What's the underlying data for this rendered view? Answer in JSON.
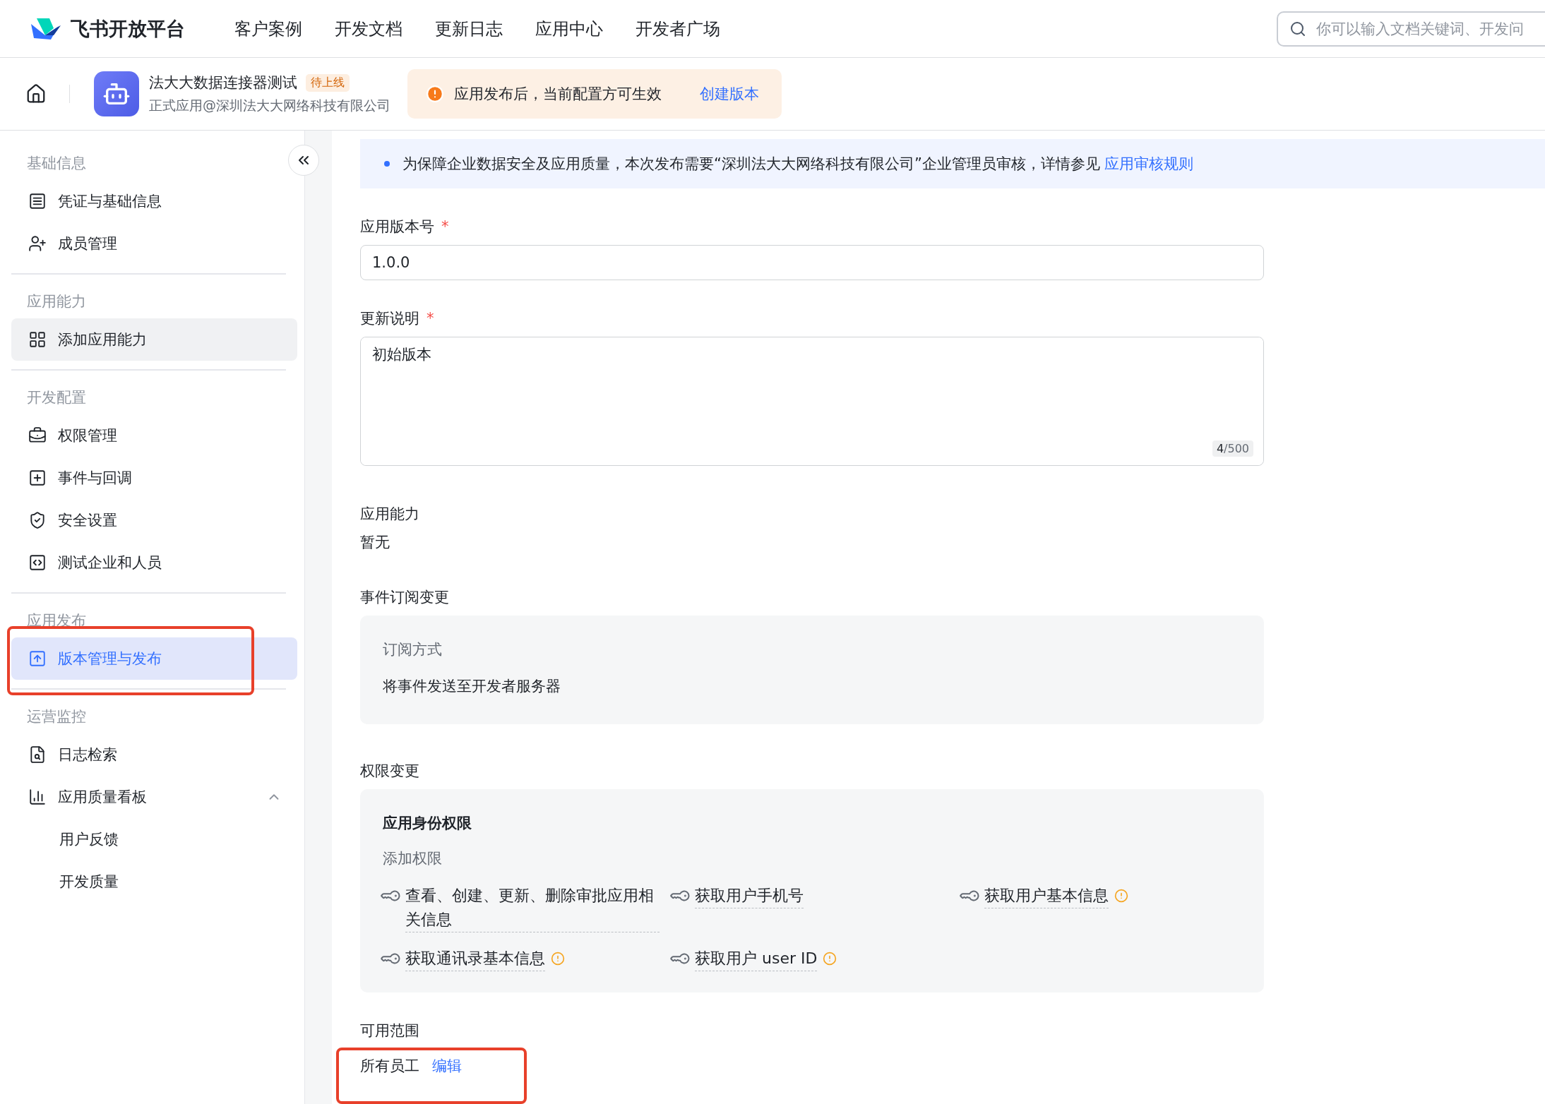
{
  "header": {
    "brand": "飞书开放平台",
    "nav": [
      {
        "label": "客户案例"
      },
      {
        "label": "开发文档"
      },
      {
        "label": "更新日志"
      },
      {
        "label": "应用中心"
      },
      {
        "label": "开发者广场"
      }
    ],
    "search": {
      "placeholder": "你可以输入文档关键词、开发问"
    }
  },
  "app_bar": {
    "app_name": "法大大数据连接器测试",
    "status": "待上线",
    "subtitle": "正式应用@深圳法大大网络科技有限公司",
    "notice": {
      "text": "应用发布后，当前配置方可生效",
      "link": "创建版本"
    }
  },
  "sidebar": {
    "sections": [
      {
        "title": "基础信息",
        "items": [
          {
            "label": "凭证与基础信息",
            "selected": false,
            "hovered": false,
            "annotated": false
          },
          {
            "label": "成员管理",
            "selected": false,
            "hovered": false,
            "annotated": false
          }
        ]
      },
      {
        "title": "应用能力",
        "items": [
          {
            "label": "添加应用能力",
            "selected": false,
            "hovered": true,
            "annotated": false
          }
        ]
      },
      {
        "title": "开发配置",
        "items": [
          {
            "label": "权限管理",
            "selected": false,
            "hovered": false,
            "annotated": false
          },
          {
            "label": "事件与回调",
            "selected": false,
            "hovered": false,
            "annotated": false
          },
          {
            "label": "安全设置",
            "selected": false,
            "hovered": false,
            "annotated": false
          },
          {
            "label": "测试企业和人员",
            "selected": false,
            "hovered": false,
            "annotated": false
          }
        ]
      },
      {
        "title": "应用发布",
        "items": [
          {
            "label": "版本管理与发布",
            "selected": true,
            "hovered": false,
            "annotated": true
          }
        ]
      },
      {
        "title": "运营监控",
        "items": [
          {
            "label": "日志检索",
            "selected": false,
            "hovered": false,
            "annotated": false
          },
          {
            "label": "应用质量看板",
            "selected": false,
            "hovered": false,
            "annotated": false,
            "expanded": true,
            "children": [
              {
                "label": "用户反馈",
                "selected": false
              },
              {
                "label": "开发质量",
                "selected": false
              }
            ]
          }
        ]
      }
    ]
  },
  "banner": {
    "text": "为保障企业数据安全及应用质量，本次发布需要“深圳法大大网络科技有限公司”企业管理员审核，详情参见",
    "link": "应用审核规则"
  },
  "form": {
    "version": {
      "label": "应用版本号",
      "required_mark": "*",
      "value": "1.0.0"
    },
    "notes": {
      "label": "更新说明",
      "required_mark": "*",
      "value": "初始版本",
      "counter": "**4**/500"
    }
  },
  "capabilities": {
    "title": "应用能力",
    "value": "暂无"
  },
  "events": {
    "title": "事件订阅变更",
    "label": "订阅方式",
    "value": "将事件发送至开发者服务器"
  },
  "permissions": {
    "title": "权限变更",
    "group": "应用身份权限",
    "subtitle": "添加权限",
    "items": [
      {
        "label": "查看、创建、更新、删除审批应用相关信息",
        "warning": false
      },
      {
        "label": "获取用户手机号",
        "warning": false
      },
      {
        "label": "获取用户基本信息",
        "warning": true
      },
      {
        "label": "获取通讯录基本信息",
        "warning": true
      },
      {
        "label": "获取用户 user ID",
        "warning": true
      }
    ]
  },
  "scope": {
    "title": "可用范围",
    "value": "所有员工",
    "link": "编辑",
    "annotated": true
  }
}
